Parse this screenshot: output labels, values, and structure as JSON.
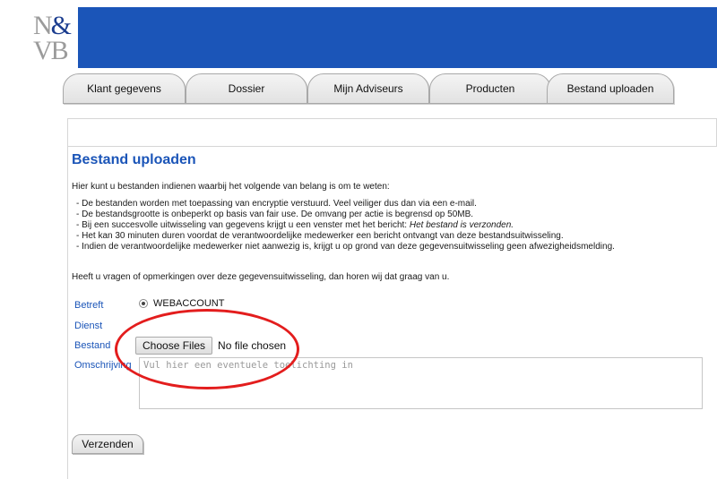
{
  "logo": {
    "top_left": "N",
    "amp": "&",
    "bottom": "VB"
  },
  "colors": {
    "brand_blue": "#1b55b8",
    "annotation_red": "#e31d1d"
  },
  "tabs": [
    {
      "label": "Klant gegevens"
    },
    {
      "label": "Dossier"
    },
    {
      "label": "Mijn Adviseurs"
    },
    {
      "label": "Producten"
    },
    {
      "label": "Bestand uploaden"
    }
  ],
  "page": {
    "title": "Bestand uploaden",
    "intro": "Hier kunt u bestanden indienen waarbij het volgende van belang is om te weten:",
    "bullets": [
      "- De bestanden worden met toepassing van encryptie verstuurd. Veel veiliger dus dan via een e-mail.",
      "- De bestandsgrootte is onbeperkt op basis van fair use. De omvang per actie is begrensd op 50MB.",
      "- Bij een succesvolle uitwisseling van gegevens krijgt u een venster met het bericht: ",
      "- Het kan 30 minuten duren voordat de verantwoordelijke medewerker een bericht ontvangt van deze bestandsuitwisseling.",
      "- Indien de verantwoordelijke medewerker niet aanwezig is, krijgt u op grond van deze gegevensuitwisseling geen afwezigheidsmelding."
    ],
    "bullet3_italic": "Het bestand is verzonden.",
    "question": "Heeft u vragen of opmerkingen over deze gegevensuitwisseling, dan horen wij dat graag van u."
  },
  "form": {
    "betreft_label": "Betreft",
    "betreft_option": "WEBACCOUNT",
    "dienst_label": "Dienst",
    "bestand_label": "Bestand",
    "file_button": "Choose Files",
    "file_status": "No file chosen",
    "omschrijving_label": "Omschrijving",
    "omschrijving_placeholder": "Vul hier een eventuele toelichting in",
    "submit_label": "Verzenden"
  }
}
